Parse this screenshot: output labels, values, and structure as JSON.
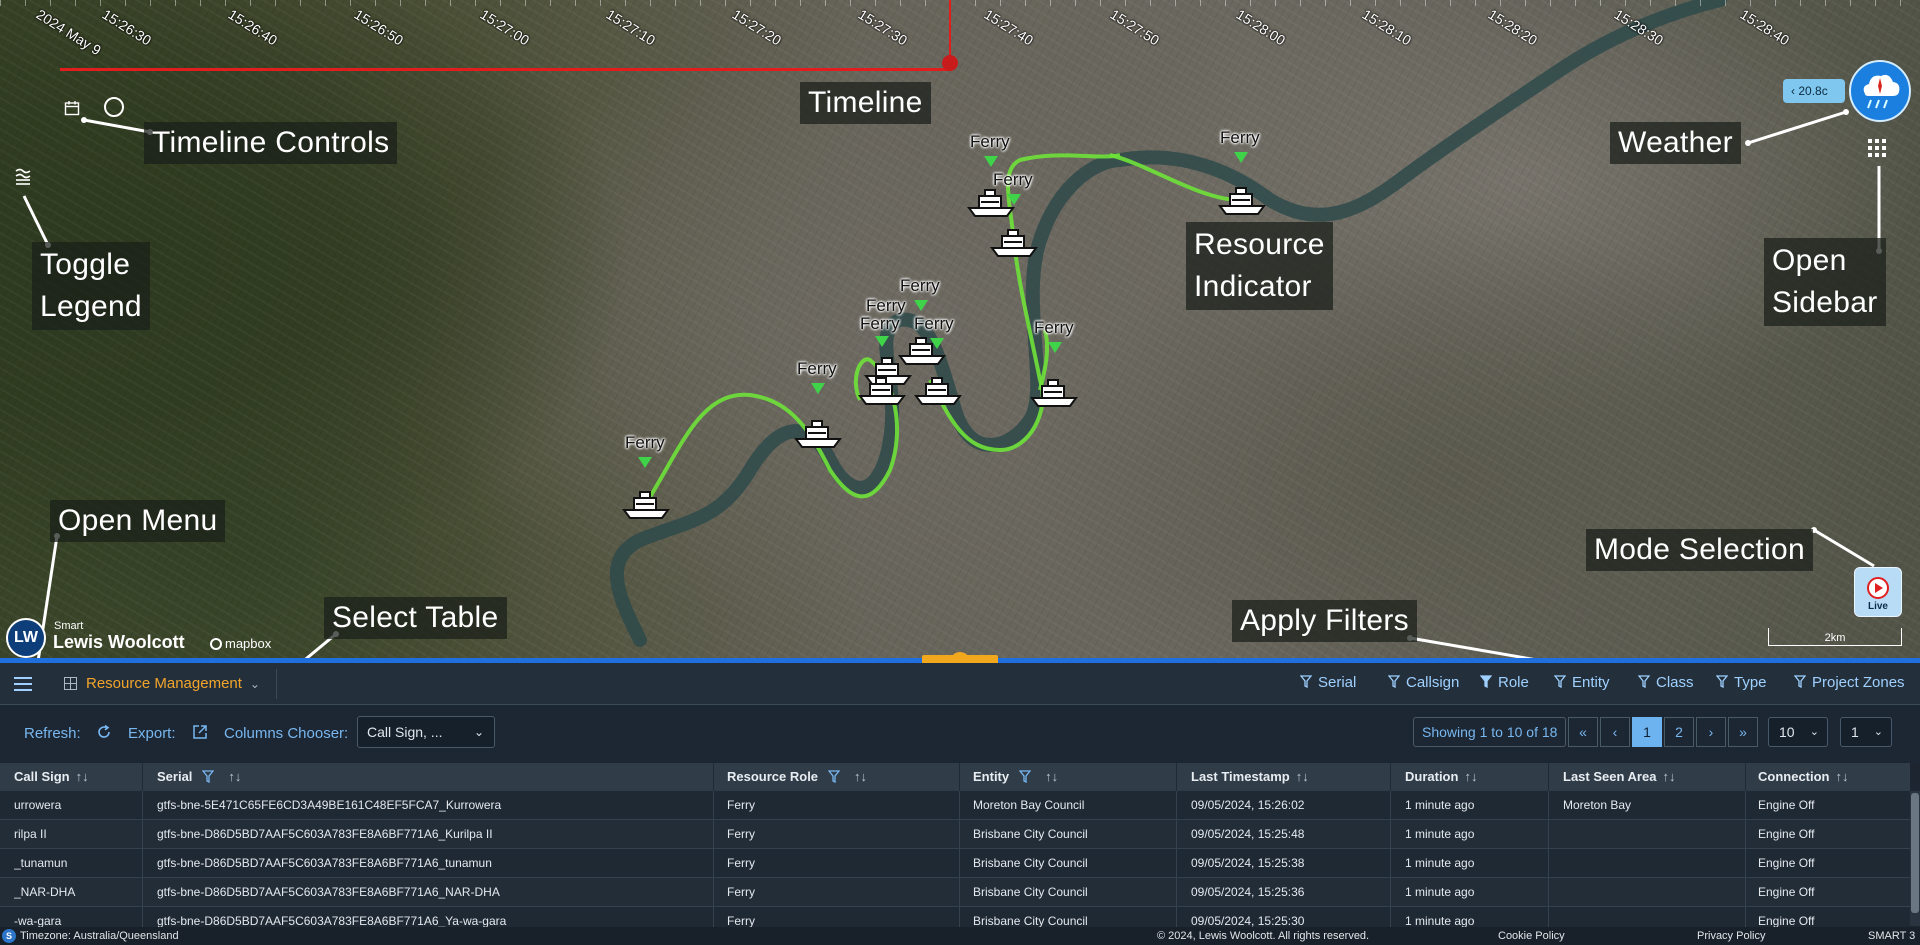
{
  "timeline": {
    "date": "2024 May 9",
    "ticks": [
      "15:26:30",
      "15:26:40",
      "15:26:50",
      "15:27:00",
      "15:27:10",
      "15:27:20",
      "15:27:30",
      "15:27:40",
      "15:27:50",
      "15:28:00",
      "15:28:10",
      "15:28:20",
      "15:28:30",
      "15:28:40"
    ]
  },
  "annotations": {
    "timeline": "Timeline",
    "timeline_controls": "Timeline Controls",
    "toggle_legend_line1": "Toggle",
    "toggle_legend_line2": "Legend",
    "weather": "Weather",
    "resource_indicator_line1": "Resource",
    "resource_indicator_line2": "Indicator",
    "open_sidebar_line1": "Open",
    "open_sidebar_line2": "Sidebar",
    "open_menu": "Open Menu",
    "mode_selection": "Mode Selection",
    "select_table": "Select Table",
    "apply_filters": "Apply Filters"
  },
  "ferry_label": "Ferry",
  "weather": {
    "temperature": "20.8c",
    "back_glyph": "‹"
  },
  "live_button": {
    "label": "Live"
  },
  "scale": "2km",
  "brand": {
    "smart": "Smart",
    "name": "Lewis Woolcott",
    "logo_text": "LW",
    "mapbox": "mapbox"
  },
  "toolbar": {
    "table_select": "Resource Management",
    "filters": [
      "Serial",
      "Callsign",
      "Role",
      "Entity",
      "Class",
      "Type",
      "Project Zones"
    ]
  },
  "controls": {
    "refresh_label": "Refresh:",
    "export_label": "Export:",
    "columns_label": "Columns Chooser:",
    "columns_value": "Call Sign, ...",
    "showing": "Showing 1 to 10 of 18",
    "pages": [
      "«",
      "‹",
      "1",
      "2",
      "›",
      "»"
    ],
    "page_size": "10",
    "page_select": "1"
  },
  "table": {
    "columns": [
      "Call Sign",
      "Serial",
      "Resource Role",
      "Entity",
      "Last Timestamp",
      "Duration",
      "Last Seen Area",
      "Connection"
    ],
    "sort_glyph": "↑↓",
    "rows": [
      [
        "urrowera",
        "gtfs-bne-5E471C65FE6CD3A49BE161C48EF5FCA7_Kurrowera",
        "Ferry",
        "Moreton Bay Council",
        "09/05/2024, 15:26:02",
        "1 minute ago",
        "Moreton Bay",
        "Engine Off"
      ],
      [
        "rilpa II",
        "gtfs-bne-D86D5BD7AAF5C603A783FE8A6BF771A6_Kurilpa II",
        "Ferry",
        "Brisbane City Council",
        "09/05/2024, 15:25:48",
        "1 minute ago",
        "",
        "Engine Off"
      ],
      [
        "_tunamun",
        "gtfs-bne-D86D5BD7AAF5C603A783FE8A6BF771A6_tunamun",
        "Ferry",
        "Brisbane City Council",
        "09/05/2024, 15:25:38",
        "1 minute ago",
        "",
        "Engine Off"
      ],
      [
        "_NAR-DHA",
        "gtfs-bne-D86D5BD7AAF5C603A783FE8A6BF771A6_NAR-DHA",
        "Ferry",
        "Brisbane City Council",
        "09/05/2024, 15:25:36",
        "1 minute ago",
        "",
        "Engine Off"
      ],
      [
        "-wa-gara",
        "gtfs-bne-D86D5BD7AAF5C603A783FE8A6BF771A6_Ya-wa-gara",
        "Ferry",
        "Brisbane City Council",
        "09/05/2024, 15:25:30",
        "1 minute ago",
        "",
        "Engine Off"
      ]
    ]
  },
  "footer": {
    "timezone": "Timezone: Australia/Queensland",
    "copyright": "© 2024, Lewis Woolcott. All rights reserved.",
    "cookie": "Cookie Policy",
    "privacy": "Privacy Policy",
    "version": "SMART 3",
    "badge": "S"
  },
  "colors": {
    "accent": "#1f6fde",
    "timeline": "#e11d1d",
    "table_select": "#f2a42a",
    "link": "#78b7f0",
    "track": "#6fe23a"
  }
}
